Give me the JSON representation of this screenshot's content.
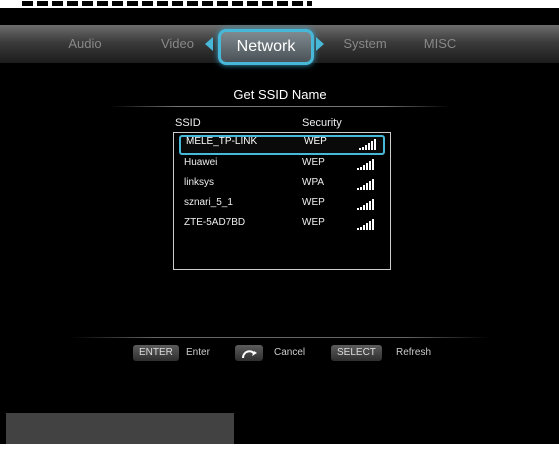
{
  "tabs": {
    "audio": "Audio",
    "video": "Video",
    "network": "Network",
    "system": "System",
    "misc": "MISC"
  },
  "page_title": "Get SSID Name",
  "columns": {
    "ssid": "SSID",
    "security": "Security"
  },
  "networks": [
    {
      "ssid": "MELE_TP-LINK",
      "security": "WEP",
      "selected": true
    },
    {
      "ssid": "Huawei",
      "security": "WEP"
    },
    {
      "ssid": "linksys",
      "security": "WPA"
    },
    {
      "ssid": "sznari_5_1",
      "security": "WEP"
    },
    {
      "ssid": "ZTE-5AD7BD",
      "security": "WEP"
    }
  ],
  "footer": {
    "enter_key": "ENTER",
    "enter_label": "Enter",
    "back_key_icon": "back-arrow-icon",
    "cancel_label": "Cancel",
    "select_key": "SELECT",
    "refresh_label": "Refresh"
  },
  "colors": {
    "accent": "#48b8d8",
    "background": "#000000"
  }
}
